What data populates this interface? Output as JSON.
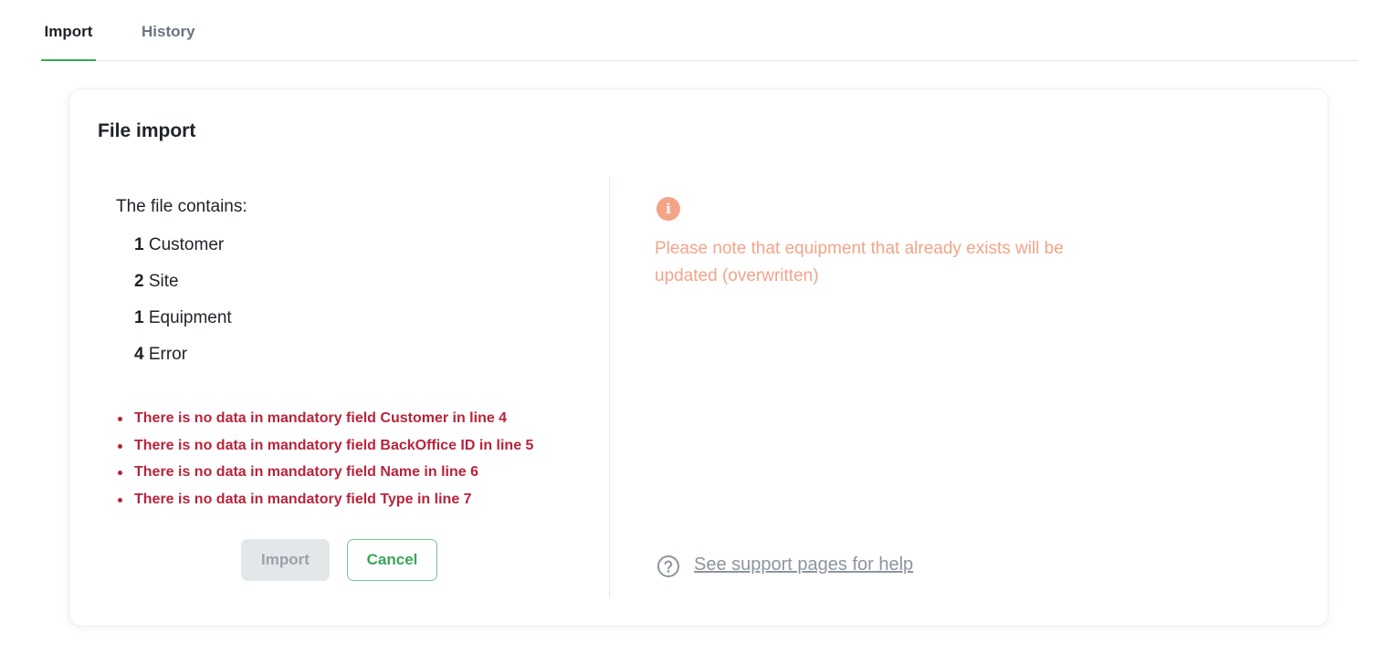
{
  "tabs": [
    {
      "label": "Import",
      "active": true
    },
    {
      "label": "History",
      "active": false
    }
  ],
  "card": {
    "title": "File import",
    "contains_label": "The file contains:",
    "counts": [
      {
        "count": "1",
        "label": " Customer"
      },
      {
        "count": "2",
        "label": " Site"
      },
      {
        "count": "1",
        "label": " Equipment"
      },
      {
        "count": "4",
        "label": " Error"
      }
    ],
    "errors": [
      "There is no data in mandatory field Customer in line 4",
      "There is no data in mandatory field BackOffice ID in line 5",
      "There is no data in mandatory field Name in line 6",
      "There is no data in mandatory field Type in line 7"
    ],
    "buttons": {
      "import_label": "Import",
      "cancel_label": "Cancel"
    },
    "note": {
      "icon": "info-icon",
      "text": "Please note that equipment that already exists will be updated (overwritten)"
    },
    "help": {
      "icon": "question-circle-icon",
      "link_text": "See support pages for help"
    }
  },
  "colors": {
    "accent": "#3aa657",
    "error": "#b8243a",
    "warning": "#f4a489"
  }
}
